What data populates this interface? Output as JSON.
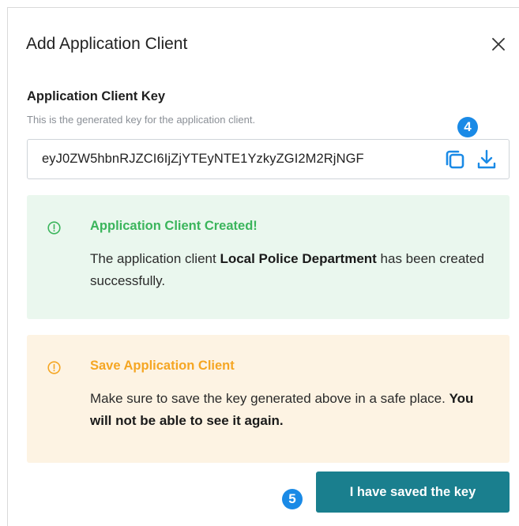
{
  "dialog": {
    "title": "Add Application Client",
    "close_icon": "close-icon"
  },
  "key_field": {
    "label": "Application Client Key",
    "help_text": "This is the generated key for the application client.",
    "value": "eyJ0ZW5hbnRJZCI6IjZjYTEyNTE1YzkyZGI2M2RjNGF",
    "copy_icon": "copy-icon",
    "download_icon": "download-icon"
  },
  "step_badges": {
    "badge_4": "4",
    "badge_5": "5"
  },
  "success_alert": {
    "icon": "info-circle-icon",
    "title": "Application Client Created!",
    "body_prefix": "The application client ",
    "client_name": "Local Police Department",
    "body_suffix": " has been created successfully.",
    "color": "#3bb55c",
    "background": "#eaf7ee"
  },
  "warning_alert": {
    "icon": "info-circle-icon",
    "title": "Save Application Client",
    "body_prefix": "Make sure to save the key generated above in a safe place. ",
    "body_bold": "You will not be able to see it again.",
    "color": "#f5a623",
    "background": "#fdf3e3"
  },
  "footer": {
    "confirm_label": "I have saved the key",
    "confirm_color": "#1a7f8e"
  }
}
